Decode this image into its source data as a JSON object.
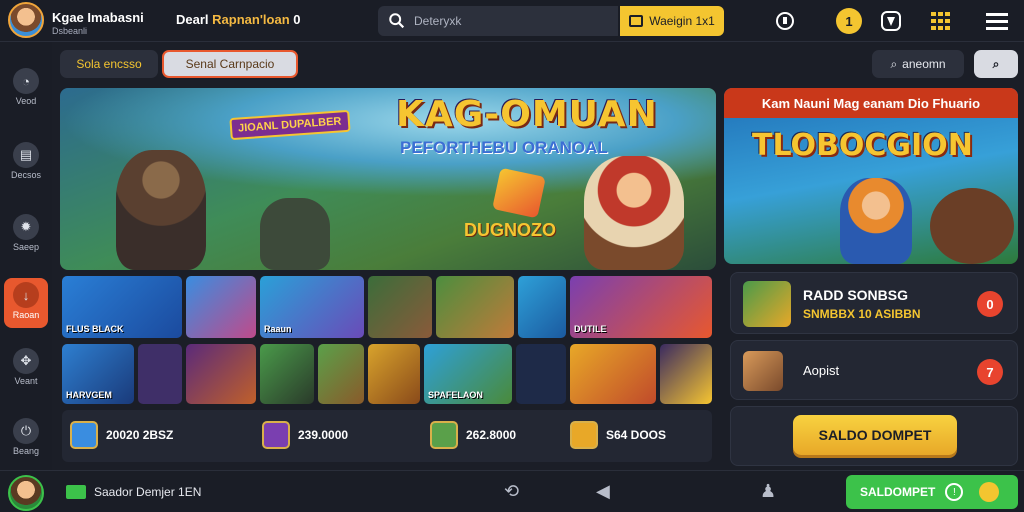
{
  "header": {
    "brand": "Kgae Imabasni",
    "brand_sub": "Dsbeanli",
    "app_name_prefix": "Dearl",
    "app_name_accent": "Rapnan'loan",
    "app_name_suffix": "0",
    "search_placeholder": "Deteryxk",
    "search_button": "Waeigin 1x1",
    "coins": "1"
  },
  "sidebar": {
    "items": [
      {
        "label": "Veod",
        "icon": "clock-icon",
        "glyph": "◔"
      },
      {
        "label": "Decsos",
        "icon": "chat-icon",
        "glyph": "▤"
      },
      {
        "label": "Saeep",
        "icon": "gear-icon",
        "glyph": "✹"
      },
      {
        "label": "Raoan",
        "icon": "download-icon",
        "glyph": "↓"
      },
      {
        "label": "Veant",
        "icon": "gamepad-icon",
        "glyph": "✥"
      },
      {
        "label": "Beang",
        "icon": "power-icon",
        "glyph": "⏻"
      }
    ]
  },
  "filters": {
    "pill1": "Sola encsso",
    "pill2": "Senal Carnpacio",
    "right_pill": "aneomn"
  },
  "hero": {
    "title": "KAG-OMUAN",
    "subtitle": "PEFORTHEBU ORANOAL",
    "badge": "JIOANL DUPALBER",
    "tag": "DUGNOZO"
  },
  "promo": {
    "header": "Kam Nauni Mag eanam Dio Fhuario",
    "title": "TLOBOCGION"
  },
  "tiles_row1": [
    {
      "title": "FLUS BLACK",
      "bg": "#2a7fd6"
    },
    {
      "title": "",
      "bg": "#3a8de0"
    },
    {
      "title": "Raaun",
      "bg": "#6a4bb8"
    },
    {
      "title": "",
      "bg": "#3b6d3a"
    },
    {
      "title": "",
      "bg": "#4c8e3e"
    },
    {
      "title": "",
      "bg": "#2ea0d8"
    },
    {
      "title": "DUTILE",
      "bg": "#7a3fb0"
    }
  ],
  "tiles_row2": [
    {
      "title": "HARVGEM",
      "bg": "#2e7fd0"
    },
    {
      "title": "",
      "bg": "#3f2f68"
    },
    {
      "title": "",
      "bg": "#5a2a7a"
    },
    {
      "title": "",
      "bg": "#4a9a4a"
    },
    {
      "title": "",
      "bg": "#5aa04a"
    },
    {
      "title": "",
      "bg": "#d8a32c"
    },
    {
      "title": "SPAFELAON",
      "bg": "#2ea0d8"
    },
    {
      "title": "",
      "bg": "#1e2a48"
    },
    {
      "title": "",
      "bg": "#e8a828"
    },
    {
      "title": "",
      "bg": "#3a2a60"
    }
  ],
  "stats": [
    {
      "value": "20020 2BSZ"
    },
    {
      "value": "239.0000"
    },
    {
      "value": "262.8000"
    },
    {
      "value": "S64 DOOS"
    }
  ],
  "right_panel": {
    "card1_title": "RADD SONBSG",
    "card1_sub": "SNMBBX 10 ASIBBN",
    "card1_btn": "0",
    "card2_title": "Aopist",
    "card2_btn": "7",
    "cta": "SALDO DOMPET"
  },
  "bottom": {
    "status": "Saador Demjer 1EN",
    "cta": "SALDOMPET"
  },
  "colors": {
    "accent": "#f4c530",
    "orange": "#e8582e",
    "green": "#3cc24a",
    "red": "#e8442e"
  }
}
